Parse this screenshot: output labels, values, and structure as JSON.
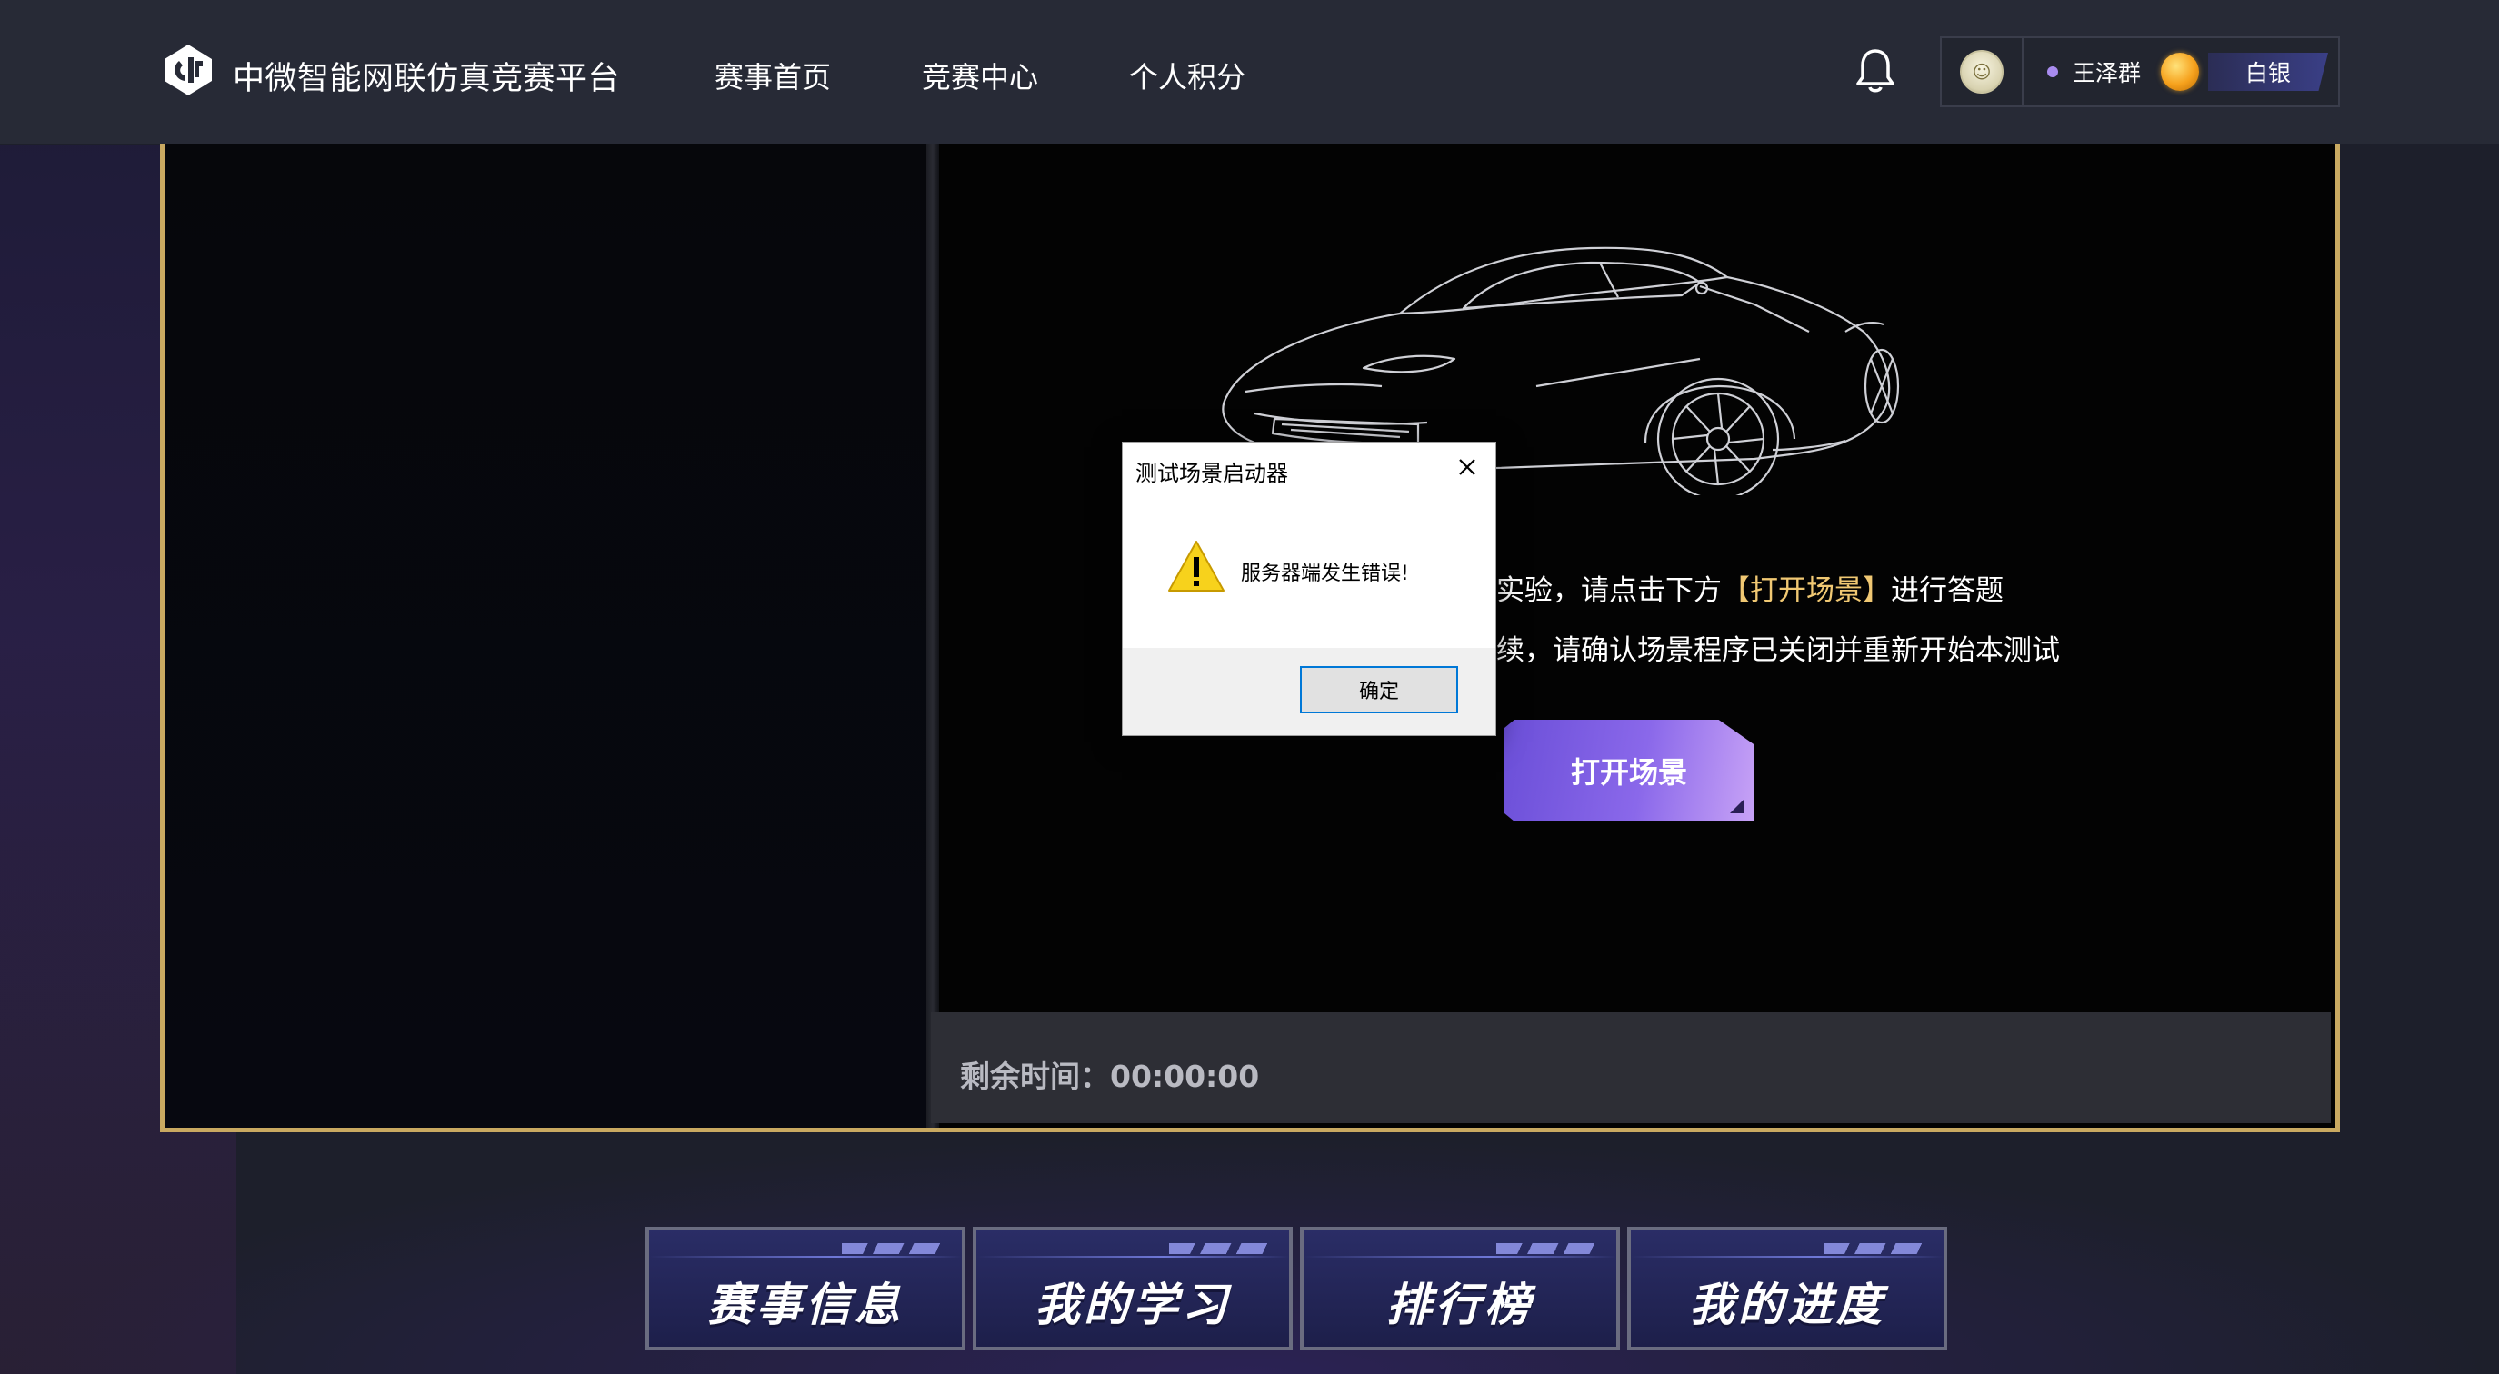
{
  "header": {
    "brand": "中微智能网联仿真竞赛平台",
    "nav": [
      "赛事首页",
      "竞赛中心",
      "个人积分"
    ],
    "user": {
      "name": "王泽群",
      "rank": "白银"
    }
  },
  "main": {
    "instruction_line1_prefix": "实验，请点击下方",
    "instruction_line1_highlight": "【打开场景】",
    "instruction_line1_suffix": "进行答题",
    "instruction_line2": "续，请确认场景程序已关闭并重新开始本测试",
    "open_button": "打开场景",
    "timer_label": "剩余时间：",
    "timer_value": "00:00:00"
  },
  "tabs": [
    "赛事信息",
    "我的学习",
    "排行榜",
    "我的进度"
  ],
  "dialog": {
    "title": "测试场景启动器",
    "message": "服务器端发生错误!",
    "ok": "确定"
  },
  "colors": {
    "frame_border": "#c9a961",
    "highlight": "#f0c873",
    "accent_purple": "#8a68ea"
  }
}
